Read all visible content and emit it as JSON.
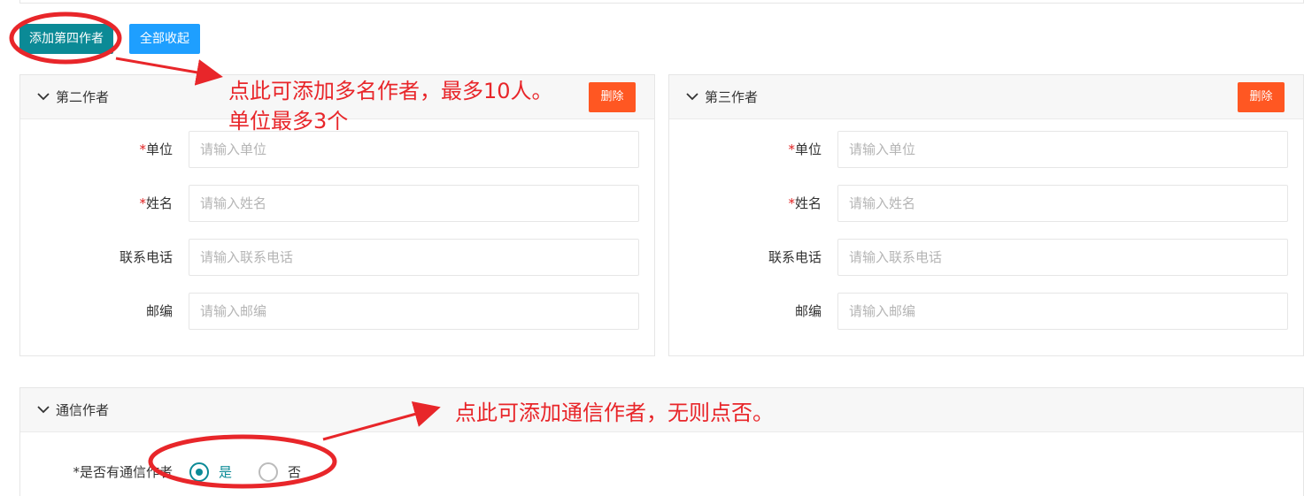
{
  "colors": {
    "primary": "#0b8a96",
    "blue": "#1e9fff",
    "danger": "#ff5722",
    "annotation": "#e8262a"
  },
  "toolbar": {
    "add_label": "添加第四作者",
    "collapse_label": "全部收起"
  },
  "panels": [
    {
      "title": "第二作者",
      "delete_label": "删除",
      "fields": [
        {
          "label": "单位",
          "required": true,
          "placeholder": "请输入单位",
          "value": ""
        },
        {
          "label": "姓名",
          "required": true,
          "placeholder": "请输入姓名",
          "value": ""
        },
        {
          "label": "联系电话",
          "required": false,
          "placeholder": "请输入联系电话",
          "value": ""
        },
        {
          "label": "邮编",
          "required": false,
          "placeholder": "请输入邮编",
          "value": ""
        }
      ]
    },
    {
      "title": "第三作者",
      "delete_label": "删除",
      "fields": [
        {
          "label": "单位",
          "required": true,
          "placeholder": "请输入单位",
          "value": ""
        },
        {
          "label": "姓名",
          "required": true,
          "placeholder": "请输入姓名",
          "value": ""
        },
        {
          "label": "联系电话",
          "required": false,
          "placeholder": "请输入联系电话",
          "value": ""
        },
        {
          "label": "邮编",
          "required": false,
          "placeholder": "请输入邮编",
          "value": ""
        }
      ]
    }
  ],
  "correspondence": {
    "title": "通信作者",
    "question_label": "是否有通信作者",
    "required_mark": "*",
    "options": [
      {
        "label": "是",
        "selected": true
      },
      {
        "label": "否",
        "selected": false
      }
    ]
  },
  "annotations": {
    "add_hint_line1": "点此可添加多名作者，最多10人。",
    "add_hint_line2": "单位最多3个",
    "corr_hint": "点此可添加通信作者，无则点否。"
  },
  "required_mark": "*",
  "icons": {
    "collapse": "chevron-down-icon"
  }
}
